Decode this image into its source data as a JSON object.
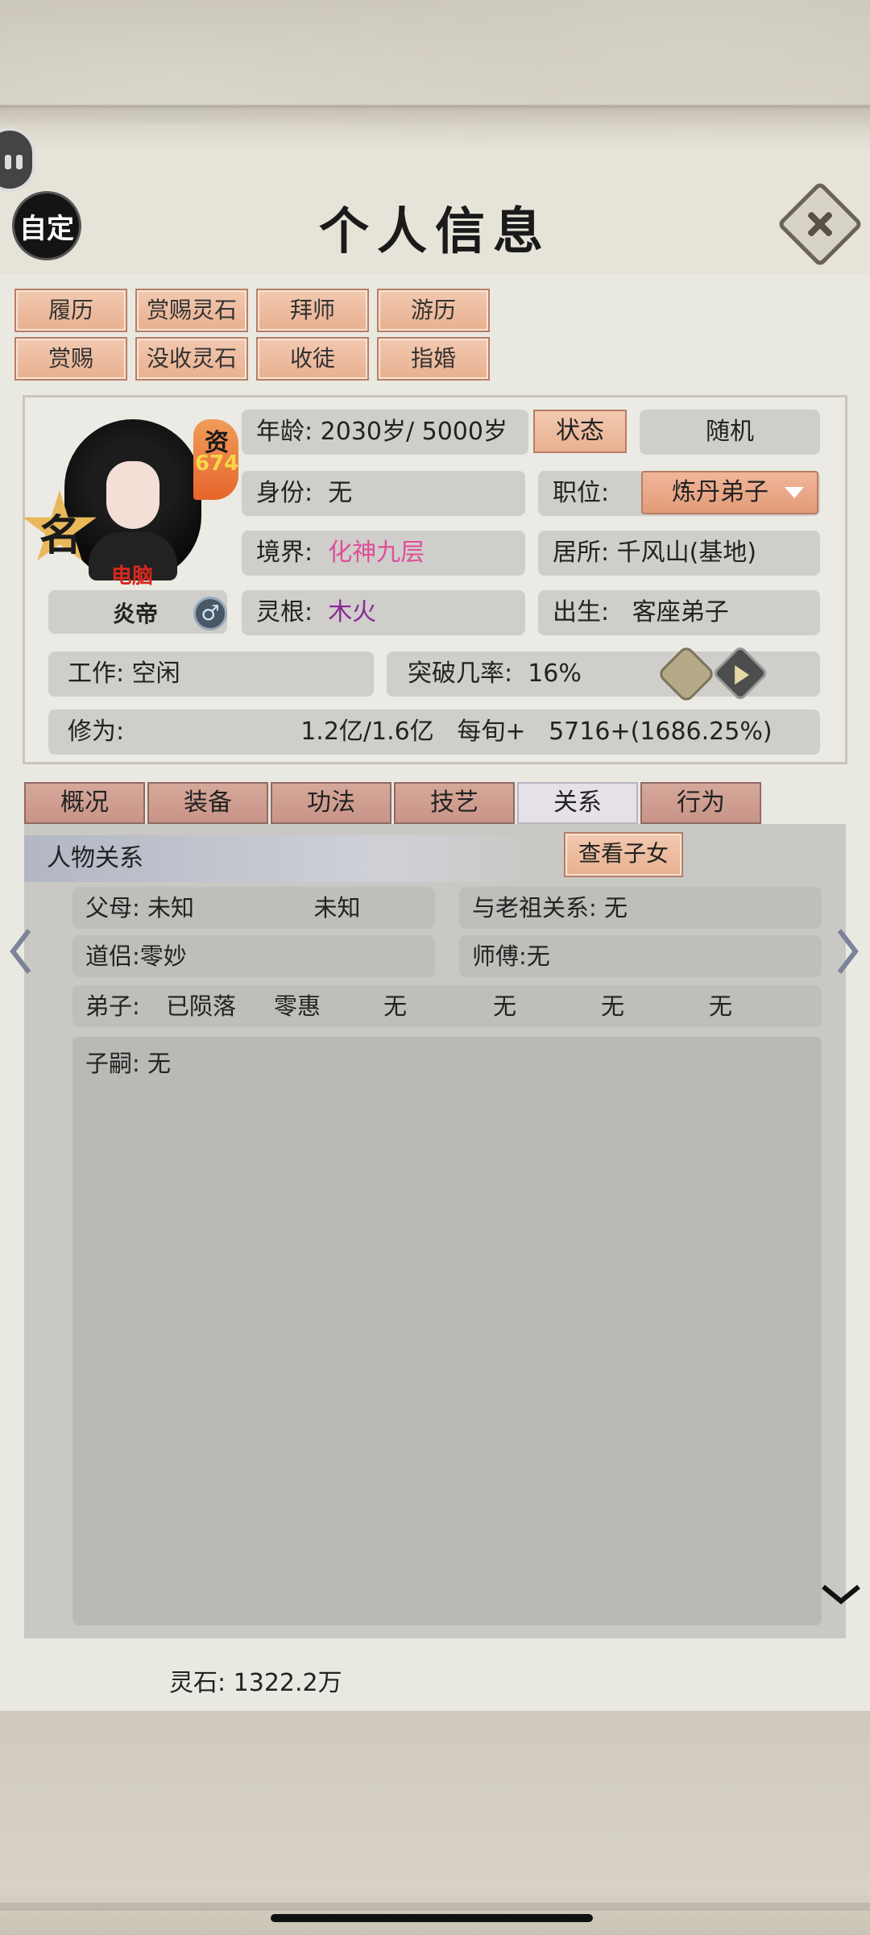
{
  "header": {
    "title": "个人信息",
    "custom_label": "自定"
  },
  "actions": {
    "row1": [
      "履历",
      "赏赐灵石",
      "拜师",
      "游历"
    ],
    "row2": [
      "赏赐",
      "没收灵石",
      "收徒",
      "指婚"
    ]
  },
  "character": {
    "name_badge": "名",
    "aptitude_label": "资",
    "aptitude_value": "674",
    "controller": "电脑",
    "title": "炎帝",
    "gender_symbol": "♂",
    "age": "年龄: 2030岁/ 5000岁",
    "status_button": "状态",
    "random_button": "随机",
    "identity_label": "身份:",
    "identity_value": "无",
    "position_label": "职位:",
    "position_value": "炼丹弟子",
    "realm_label": "境界:",
    "realm_value": "化神九层",
    "residence": "居所: 千风山(基地)",
    "root_label": "灵根:",
    "root_value": "木火",
    "birth_label": "出生:",
    "birth_value": "客座弟子",
    "work": "工作: 空闲",
    "breakthrough_label": "突破几率:",
    "breakthrough_value": "16%",
    "cultivation_label": "修为:",
    "cultivation_value": "1.2亿/1.6亿",
    "rate_label": "每旬+",
    "rate_value": "5716+(1686.25%)"
  },
  "tabs": [
    {
      "label": "概况",
      "active": false
    },
    {
      "label": "装备",
      "active": false
    },
    {
      "label": "功法",
      "active": false
    },
    {
      "label": "技艺",
      "active": false
    },
    {
      "label": "关系",
      "active": true
    },
    {
      "label": "行为",
      "active": false
    }
  ],
  "relations": {
    "section_title": "人物关系",
    "view_children_button": "查看子女",
    "parents_label": "父母:",
    "parent1": "未知",
    "parent2": "未知",
    "ancestor": "与老祖关系: 无",
    "partner": "道侣:零妙",
    "master": "师傅:无",
    "disciples_label": "弟子:",
    "disciples": [
      "已陨落",
      "零惠",
      "无",
      "无",
      "无",
      "无"
    ],
    "heirs": "子嗣: 无"
  },
  "footer": {
    "spirit_stones": "灵石: 1322.2万"
  },
  "colors": {
    "accent_button": "#e8b090",
    "realm": "#df4e9b",
    "root": "#8a2a96",
    "controller": "#d8281d"
  }
}
